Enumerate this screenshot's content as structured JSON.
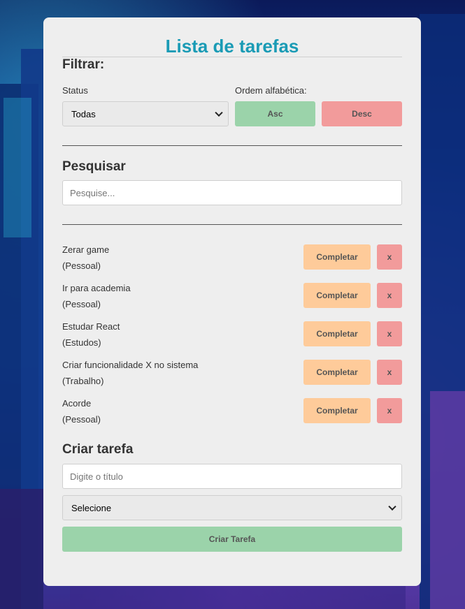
{
  "app": {
    "title": "Lista de tarefas"
  },
  "filter": {
    "heading": "Filtrar:",
    "status_label": "Status",
    "status_value": "Todas",
    "order_label": "Ordem alfabética:",
    "asc_label": "Asc",
    "desc_label": "Desc"
  },
  "search": {
    "heading": "Pesquisar",
    "placeholder": "Pesquise..."
  },
  "tasks": [
    {
      "text": "Zerar game",
      "category": "(Pessoal)",
      "complete_label": "Completar",
      "remove_label": "x",
      "completed": false
    },
    {
      "text": "Ir para academia",
      "category": "(Pessoal)",
      "complete_label": "Completar",
      "remove_label": "x",
      "completed": false
    },
    {
      "text": "Estudar React",
      "category": "(Estudos)",
      "complete_label": "Completar",
      "remove_label": "x",
      "completed": false
    },
    {
      "text": "Criar funcionalidade X no sistema",
      "category": "(Trabalho)",
      "complete_label": "Completar",
      "remove_label": "x",
      "completed": true
    },
    {
      "text": "Acorde",
      "category": "(Pessoal)",
      "complete_label": "Completar",
      "remove_label": "x",
      "completed": false
    }
  ],
  "create": {
    "heading": "Criar tarefa",
    "title_placeholder": "Digite o título",
    "category_value": "Selecione",
    "submit_label": "Criar Tarefa"
  },
  "colors": {
    "accent": "#1a9bb5",
    "asc_button": "#9bd3aa",
    "desc_button": "#f29b9b",
    "complete_button": "#fecb9a",
    "remove_button": "#f29b9b"
  }
}
